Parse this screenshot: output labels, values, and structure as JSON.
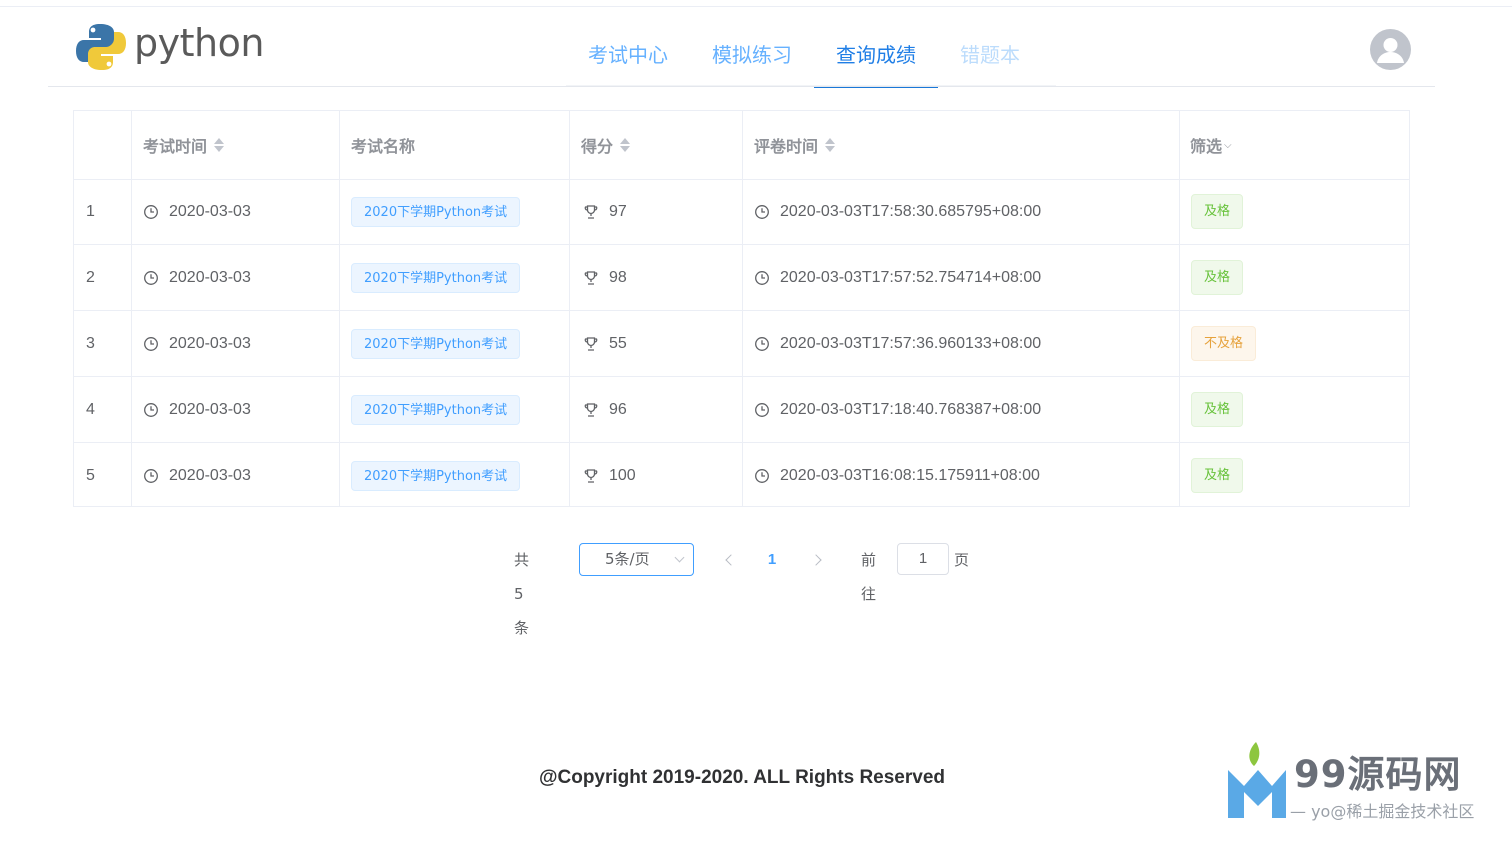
{
  "brand": {
    "name": "python"
  },
  "nav": {
    "items": [
      {
        "label": "考试中心"
      },
      {
        "label": "模拟练习"
      },
      {
        "label": "查询成绩"
      },
      {
        "label": "错题本"
      }
    ],
    "active_index": 2
  },
  "table": {
    "headers": {
      "exam_time": "考试时间",
      "exam_name": "考试名称",
      "score": "得分",
      "review_time": "评卷时间",
      "filter": "筛选"
    },
    "rows": [
      {
        "index": "1",
        "exam_time": "2020-03-03",
        "exam_name": "2020下学期Python考试",
        "score": "97",
        "review_time": "2020-03-03T17:58:30.685795+08:00",
        "status": "及格",
        "status_color": "#67c23a"
      },
      {
        "index": "2",
        "exam_time": "2020-03-03",
        "exam_name": "2020下学期Python考试",
        "score": "98",
        "review_time": "2020-03-03T17:57:52.754714+08:00",
        "status": "及格",
        "status_color": "#67c23a"
      },
      {
        "index": "3",
        "exam_time": "2020-03-03",
        "exam_name": "2020下学期Python考试",
        "score": "55",
        "review_time": "2020-03-03T17:57:36.960133+08:00",
        "status": "不及格",
        "status_color": "#e6a23c"
      },
      {
        "index": "4",
        "exam_time": "2020-03-03",
        "exam_name": "2020下学期Python考试",
        "score": "96",
        "review_time": "2020-03-03T17:18:40.768387+08:00",
        "status": "及格",
        "status_color": "#67c23a"
      },
      {
        "index": "5",
        "exam_time": "2020-03-03",
        "exam_name": "2020下学期Python考试",
        "score": "100",
        "review_time": "2020-03-03T16:08:15.175911+08:00",
        "status": "及格",
        "status_color": "#67c23a"
      }
    ]
  },
  "pagination": {
    "total_text": "共 5 条",
    "page_size": "5条/页",
    "current_page": "1",
    "goto_label": "前往",
    "goto_value": "1",
    "goto_suffix": "页"
  },
  "footer": {
    "copyright": "@Copyright 2019-2020. ALL Rights Reserved"
  },
  "watermark": {
    "name": "99源码网",
    "sub": "— yo@稀土掘金技术社区"
  },
  "colors": {
    "accent": "#409eff",
    "nav_active": "#1a78d8",
    "pass": "#67c23a",
    "fail": "#e6a23c"
  }
}
